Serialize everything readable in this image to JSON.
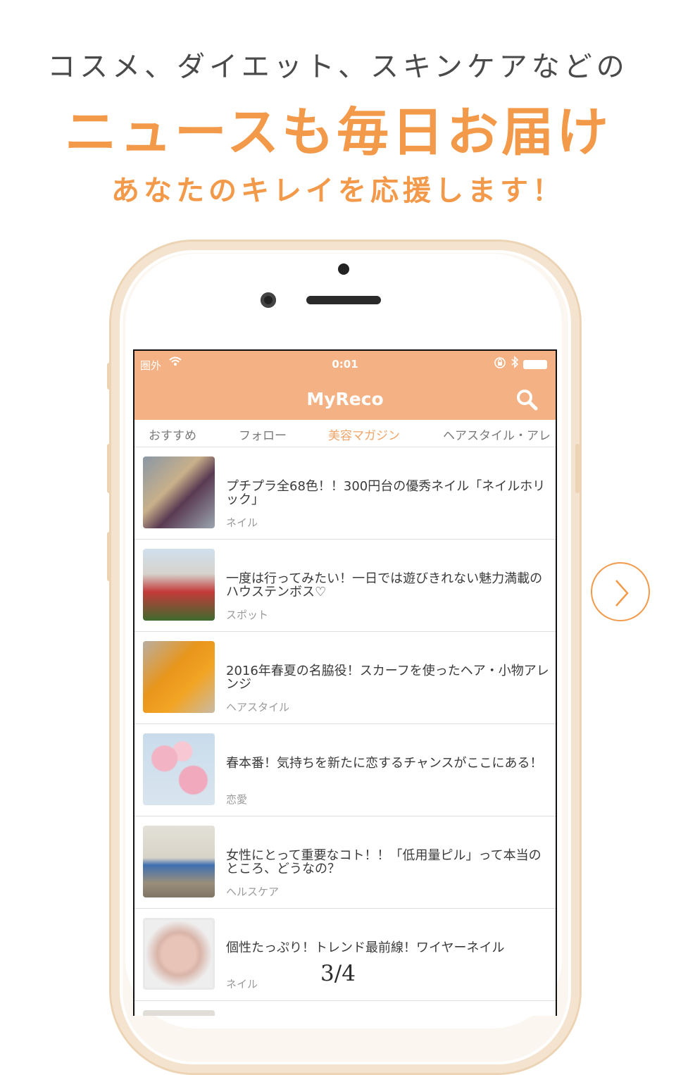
{
  "headline": {
    "line1": "コスメ、ダイエット、スキンケアなどの",
    "line2": "ニュースも毎日お届け",
    "line3": "あなたのキレイを応援します！"
  },
  "status_bar": {
    "carrier": "圏外",
    "time": "0:01"
  },
  "app": {
    "title": "MyReco"
  },
  "tabs": [
    {
      "label": "おすすめ",
      "active": false
    },
    {
      "label": "フォロー",
      "active": false
    },
    {
      "label": "美容マガジン",
      "active": true
    },
    {
      "label": "ヘアスタイル・アレ",
      "active": false
    }
  ],
  "articles": [
    {
      "title": "プチプラ全68色！！300円台の優秀ネイル「ネイルホリック」",
      "category": "ネイル",
      "thumb_icon": "nail-polish-photo"
    },
    {
      "title": "一度は行ってみたい！一日では遊びきれない魅力満載のハウステンボス♡",
      "category": "スポット",
      "thumb_icon": "flower-garden-photo"
    },
    {
      "title": "2016年春夏の名脇役！スカーフを使ったヘア・小物アレンジ",
      "category": "ヘアスタイル",
      "thumb_icon": "handbag-photo"
    },
    {
      "title": "春本番！気持ちを新たに恋するチャンスがここにある！",
      "category": "恋愛",
      "thumb_icon": "cherry-blossom-photo"
    },
    {
      "title": "女性にとって重要なコト！！「低用量ピル」って本当のところ、どうなの？",
      "category": "ヘルスケア",
      "thumb_icon": "woman-photo"
    },
    {
      "title": "個性たっぷり！トレンド最前線！ワイヤーネイル",
      "category": "ネイル",
      "thumb_icon": "nail-art-photo"
    }
  ],
  "page_indicator": "3/4",
  "colors": {
    "accent": "#f39a4a",
    "app_header": "#f4b183",
    "active_tab": "#f0a56a"
  }
}
